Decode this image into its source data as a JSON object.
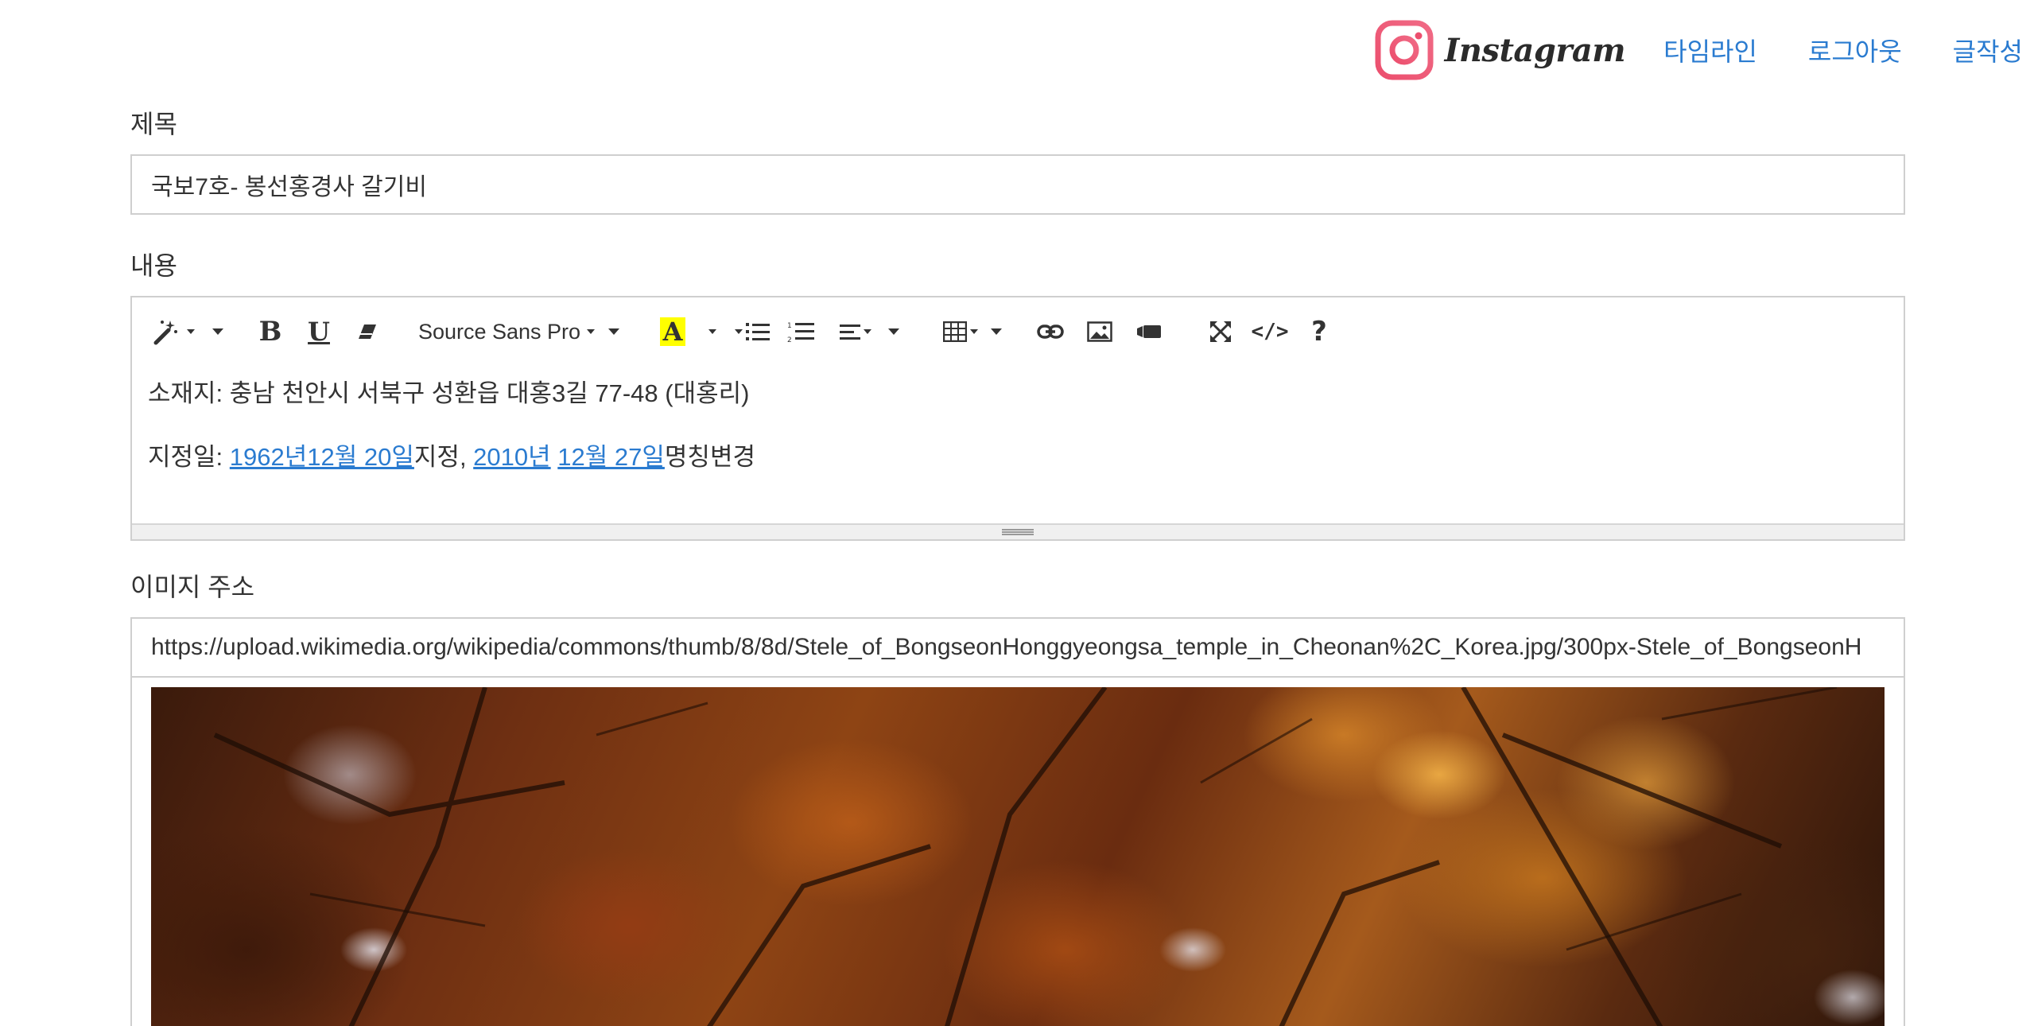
{
  "nav": {
    "brand_text": "Instagram",
    "links": [
      "타임라인",
      "로그아웃",
      "글작성"
    ],
    "brand_gradient": [
      "#f05a7e",
      "#e14b6a"
    ]
  },
  "form": {
    "title_label": "제목",
    "title_value": "국보7호- 봉선홍경사 갈기비",
    "content_label": "내용",
    "image_label": "이미지 주소",
    "image_url": "https://upload.wikimedia.org/wikipedia/commons/thumb/8/8d/Stele_of_BongseonHonggyeongsa_temple_in_Cheonan%2C_Korea.jpg/300px-Stele_of_BongseonH"
  },
  "editor": {
    "toolbar": {
      "font_name": "Source Sans Pro",
      "bold": "B",
      "underline": "U",
      "color": "A",
      "code": "</>",
      "help": "?"
    },
    "line1": "소재지: 충남 천안시 서북구 성환읍 대홍3길 77-48 (대홍리)",
    "line2": {
      "prefix": "지정일: ",
      "link1": "1962년12월 20일",
      "mid": "지정, ",
      "link2": "2010년",
      "link3": "12월 27일",
      "suffix": "명칭변경"
    }
  },
  "icons": [
    "magic-icon",
    "eraser-icon",
    "unordered-list-icon",
    "ordered-list-icon",
    "align-icon",
    "table-icon",
    "link-icon",
    "picture-icon",
    "video-icon",
    "fullscreen-icon",
    "code-icon",
    "help-icon",
    "resize-grip-icon"
  ]
}
